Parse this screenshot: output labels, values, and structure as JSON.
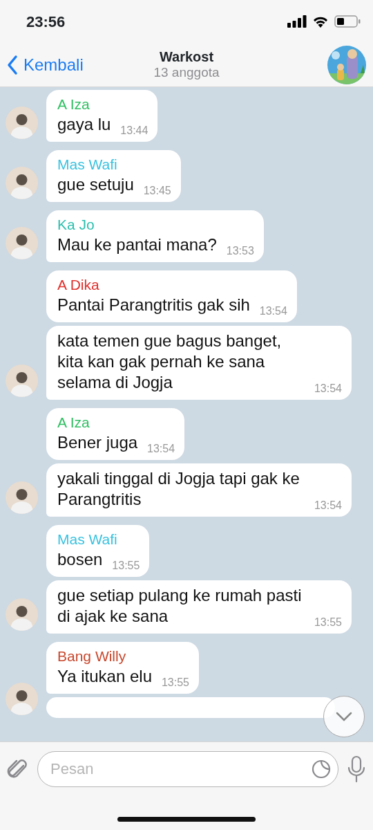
{
  "status_bar": {
    "time": "23:56"
  },
  "header": {
    "back": "Kembali",
    "title": "Warkost",
    "subtitle": "13 anggota"
  },
  "groups": [
    {
      "sender": "A Iza",
      "color": "#2fbf62",
      "messages": [
        {
          "kind": "text",
          "text": "gaya lu",
          "time": "13:44"
        }
      ]
    },
    {
      "sender": "Mas Wafi",
      "color": "#39c2df",
      "messages": [
        {
          "kind": "text",
          "text": "gue setuju",
          "time": "13:45"
        }
      ]
    },
    {
      "sender": "Ka Jo",
      "color": "#2bbfae",
      "messages": [
        {
          "kind": "text",
          "text": "Mau ke pantai mana?",
          "time": "13:53"
        }
      ]
    },
    {
      "sender": "A Dika",
      "color": "#e0302c",
      "messages": [
        {
          "kind": "text",
          "text": "Pantai Parangtritis gak sih",
          "time": "13:54"
        },
        {
          "kind": "text",
          "text": "kata temen gue bagus banget, kita kan gak pernah ke sana selama di Jogja",
          "time": "13:54"
        }
      ]
    },
    {
      "sender": "A Iza",
      "color": "#2fbf62",
      "messages": [
        {
          "kind": "text",
          "text": "Bener juga",
          "time": "13:54"
        },
        {
          "kind": "text",
          "text": "yakali tinggal di Jogja tapi gak ke Parangtritis",
          "time": "13:54"
        }
      ]
    },
    {
      "sender": "Mas Wafi",
      "color": "#39c2df",
      "messages": [
        {
          "kind": "text",
          "text": "bosen",
          "time": "13:55"
        },
        {
          "kind": "text",
          "text": "gue setiap pulang ke rumah pasti di ajak ke sana",
          "time": "13:55"
        }
      ]
    },
    {
      "sender": "Bang Willy",
      "color": "#c8472c",
      "messages": [
        {
          "kind": "text",
          "text": "Ya itukan elu",
          "time": "13:55"
        },
        {
          "kind": "cut"
        }
      ]
    }
  ],
  "composer": {
    "placeholder": "Pesan"
  }
}
